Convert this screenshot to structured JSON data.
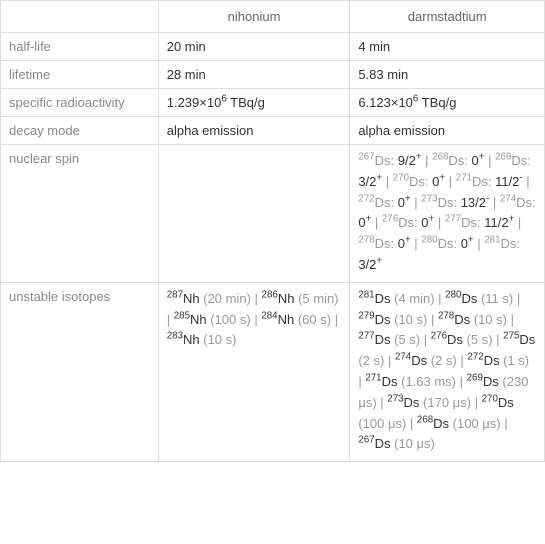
{
  "headers": {
    "nihonium": "nihonium",
    "darmstadtium": "darmstadtium"
  },
  "rows": {
    "half_life": {
      "label": "half-life",
      "nh": "20 min",
      "ds": "4 min"
    },
    "lifetime": {
      "label": "lifetime",
      "nh": "28 min",
      "ds": "5.83 min"
    },
    "specific_radioactivity": {
      "label": "specific radioactivity",
      "nh_base": "1.239×10",
      "nh_exp": "6",
      "nh_unit": " TBq/g",
      "ds_base": "6.123×10",
      "ds_exp": "6",
      "ds_unit": " TBq/g"
    },
    "decay_mode": {
      "label": "decay mode",
      "nh": "alpha emission",
      "ds": "alpha emission"
    },
    "nuclear_spin": {
      "label": "nuclear spin",
      "ds_spins": [
        {
          "mass": "267",
          "label": "Ds: ",
          "spin": "9/2",
          "sign": "+"
        },
        {
          "mass": "268",
          "label": "Ds: ",
          "spin": "0",
          "sign": "+"
        },
        {
          "mass": "269",
          "label": "Ds: ",
          "spin": "3/2",
          "sign": "+"
        },
        {
          "mass": "270",
          "label": "Ds: ",
          "spin": "0",
          "sign": "+"
        },
        {
          "mass": "271",
          "label": "Ds: ",
          "spin": "11/2",
          "sign": "-"
        },
        {
          "mass": "272",
          "label": "Ds: ",
          "spin": "0",
          "sign": "+"
        },
        {
          "mass": "273",
          "label": "Ds: ",
          "spin": "13/2",
          "sign": "-"
        },
        {
          "mass": "274",
          "label": "Ds: ",
          "spin": "0",
          "sign": "+"
        },
        {
          "mass": "276",
          "label": "Ds: ",
          "spin": "0",
          "sign": "+"
        },
        {
          "mass": "277",
          "label": "Ds: ",
          "spin": "11/2",
          "sign": "+"
        },
        {
          "mass": "278",
          "label": "Ds: ",
          "spin": "0",
          "sign": "+"
        },
        {
          "mass": "280",
          "label": "Ds: ",
          "spin": "0",
          "sign": "+"
        },
        {
          "mass": "281",
          "label": "Ds: ",
          "spin": "3/2",
          "sign": "+"
        }
      ]
    },
    "unstable_isotopes": {
      "label": "unstable isotopes",
      "nh_isotopes": [
        {
          "mass": "287",
          "sym": "Nh",
          "time": " (20 min)"
        },
        {
          "mass": "286",
          "sym": "Nh",
          "time": " (5 min)"
        },
        {
          "mass": "285",
          "sym": "Nh",
          "time": " (100 s)"
        },
        {
          "mass": "284",
          "sym": "Nh",
          "time": " (60 s)"
        },
        {
          "mass": "283",
          "sym": "Nh",
          "time": " (10 s)"
        }
      ],
      "ds_isotopes": [
        {
          "mass": "281",
          "sym": "Ds",
          "time": " (4 min)"
        },
        {
          "mass": "280",
          "sym": "Ds",
          "time": " (11 s)"
        },
        {
          "mass": "279",
          "sym": "Ds",
          "time": " (10 s)"
        },
        {
          "mass": "278",
          "sym": "Ds",
          "time": " (10 s)"
        },
        {
          "mass": "277",
          "sym": "Ds",
          "time": " (5 s)"
        },
        {
          "mass": "276",
          "sym": "Ds",
          "time": " (5 s)"
        },
        {
          "mass": "275",
          "sym": "Ds",
          "time": " (2 s)"
        },
        {
          "mass": "274",
          "sym": "Ds",
          "time": " (2 s)"
        },
        {
          "mass": "272",
          "sym": "Ds",
          "time": " (1 s)"
        },
        {
          "mass": "271",
          "sym": "Ds",
          "time": " (1.63 ms)"
        },
        {
          "mass": "269",
          "sym": "Ds",
          "time": " (230 μs)"
        },
        {
          "mass": "273",
          "sym": "Ds",
          "time": " (170 μs)"
        },
        {
          "mass": "270",
          "sym": "Ds",
          "time": " (100 μs)"
        },
        {
          "mass": "268",
          "sym": "Ds",
          "time": " (100 μs)"
        },
        {
          "mass": "267",
          "sym": "Ds",
          "time": " (10 μs)"
        }
      ]
    }
  },
  "sep": " | "
}
